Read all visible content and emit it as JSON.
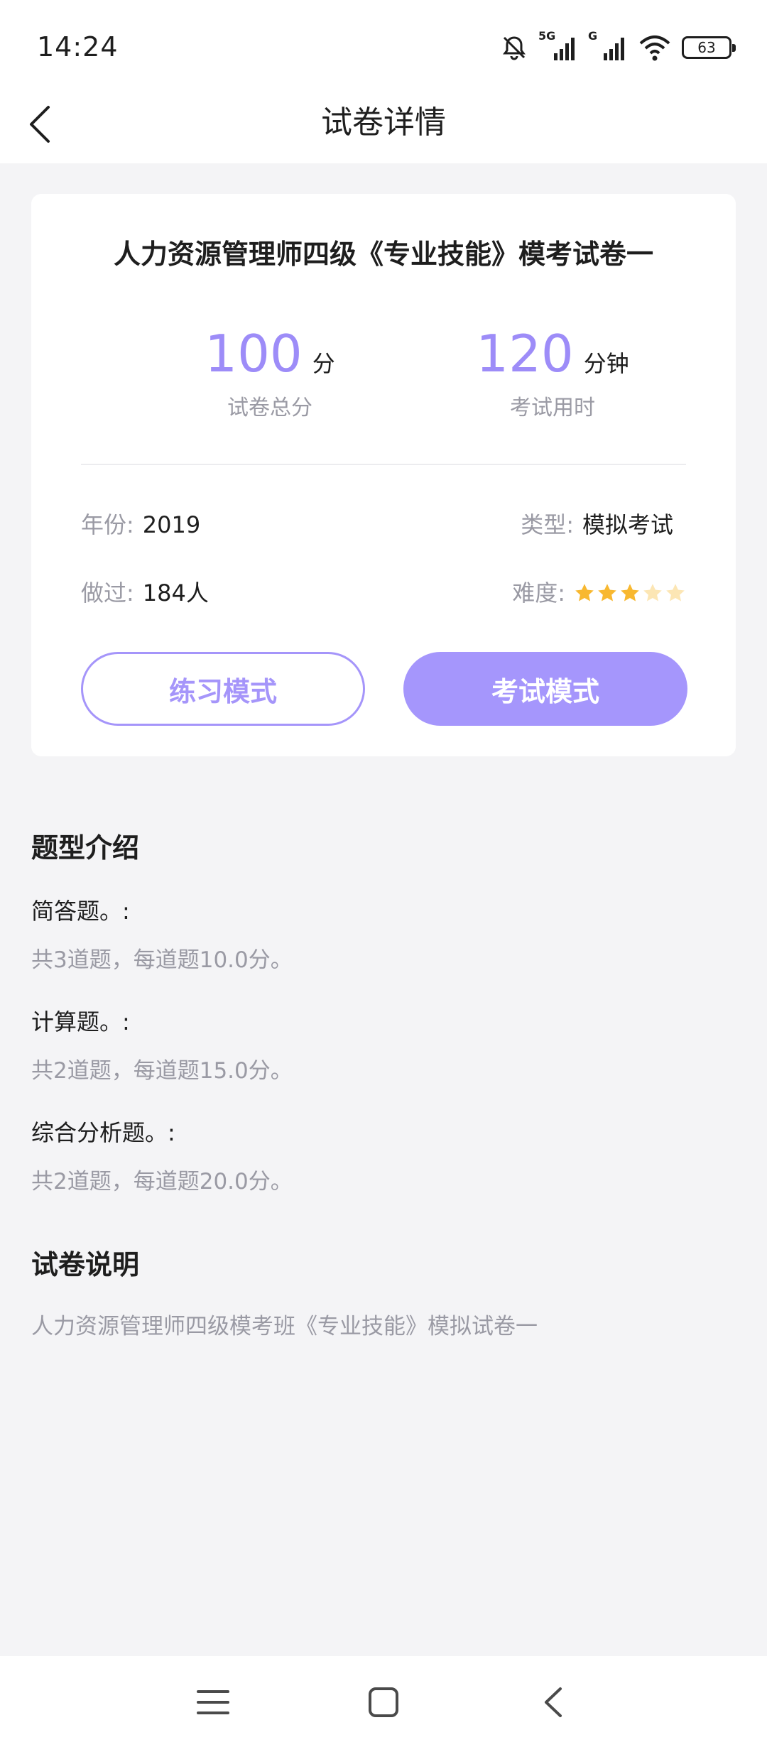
{
  "status_bar": {
    "time": "14:24",
    "network_5g": "5G",
    "network_g": "G",
    "battery": "63",
    "icons": [
      "mute-bell-icon",
      "signal-5g-icon",
      "signal-g-icon",
      "wifi-icon",
      "battery-icon"
    ]
  },
  "header": {
    "title": "试卷详情",
    "back_icon": "chevron-left-icon"
  },
  "paper": {
    "title": "人力资源管理师四级《专业技能》模考试卷一",
    "score_value": "100",
    "score_unit": "分",
    "score_label": "试卷总分",
    "time_value": "120",
    "time_unit": "分钟",
    "time_label": "考试用时",
    "year_label": "年份:",
    "year_value": "2019",
    "type_label": "类型:",
    "type_value": "模拟考试",
    "done_label": "做过:",
    "done_value": "184人",
    "difficulty_label": "难度:",
    "difficulty_stars": 3,
    "difficulty_max": 5,
    "practice_button": "练习模式",
    "exam_button": "考试模式"
  },
  "question_types": {
    "title": "题型介绍",
    "items": [
      {
        "name": "简答题。:",
        "desc": "共3道题，每道题10.0分。"
      },
      {
        "name": "计算题。:",
        "desc": "共2道题，每道题15.0分。"
      },
      {
        "name": "综合分析题。:",
        "desc": "共2道题，每道题20.0分。"
      }
    ]
  },
  "description": {
    "title": "试卷说明",
    "text": "人力资源管理师四级模考班《专业技能》模拟试卷一"
  },
  "colors": {
    "accent": "#a596fc",
    "number": "#9d8cf8",
    "star_filled": "#f8b830",
    "star_empty": "#fce6b4",
    "muted_text": "#9a9aa4",
    "background": "#f4f4f6"
  },
  "bottom_nav": {
    "icons": [
      "menu-icon",
      "home-square-icon",
      "back-triangle-icon"
    ]
  }
}
